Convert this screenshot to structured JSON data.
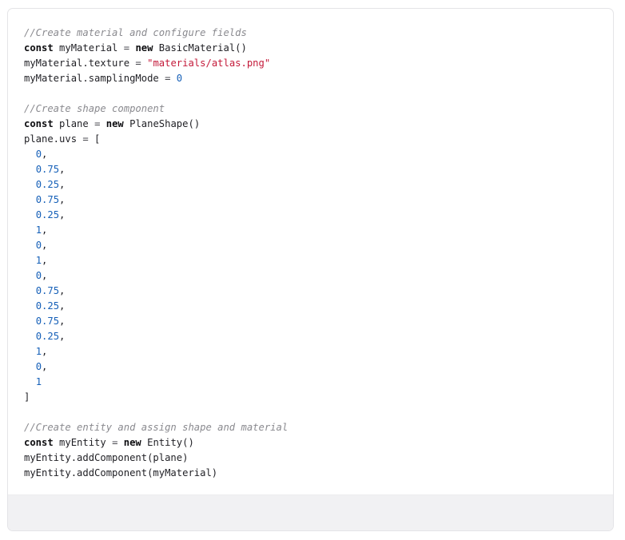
{
  "code_block": {
    "lines": [
      [
        {
          "t": "comment",
          "v": "//Create material and configure fields"
        }
      ],
      [
        {
          "t": "keyword",
          "v": "const"
        },
        {
          "t": "plain",
          "v": " myMaterial "
        },
        {
          "t": "op",
          "v": "="
        },
        {
          "t": "plain",
          "v": " "
        },
        {
          "t": "keyword",
          "v": "new"
        },
        {
          "t": "plain",
          "v": " BasicMaterial()"
        }
      ],
      [
        {
          "t": "plain",
          "v": "myMaterial.texture "
        },
        {
          "t": "op",
          "v": "="
        },
        {
          "t": "plain",
          "v": " "
        },
        {
          "t": "string",
          "v": "\"materials/atlas.png\""
        }
      ],
      [
        {
          "t": "plain",
          "v": "myMaterial.samplingMode "
        },
        {
          "t": "op",
          "v": "="
        },
        {
          "t": "plain",
          "v": " "
        },
        {
          "t": "number",
          "v": "0"
        }
      ],
      [],
      [
        {
          "t": "comment",
          "v": "//Create shape component"
        }
      ],
      [
        {
          "t": "keyword",
          "v": "const"
        },
        {
          "t": "plain",
          "v": " plane "
        },
        {
          "t": "op",
          "v": "="
        },
        {
          "t": "plain",
          "v": " "
        },
        {
          "t": "keyword",
          "v": "new"
        },
        {
          "t": "plain",
          "v": " PlaneShape()"
        }
      ],
      [
        {
          "t": "plain",
          "v": "plane.uvs "
        },
        {
          "t": "op",
          "v": "="
        },
        {
          "t": "plain",
          "v": " ["
        }
      ],
      [
        {
          "t": "plain",
          "v": "  "
        },
        {
          "t": "number",
          "v": "0"
        },
        {
          "t": "plain",
          "v": ","
        }
      ],
      [
        {
          "t": "plain",
          "v": "  "
        },
        {
          "t": "number",
          "v": "0.75"
        },
        {
          "t": "plain",
          "v": ","
        }
      ],
      [
        {
          "t": "plain",
          "v": "  "
        },
        {
          "t": "number",
          "v": "0.25"
        },
        {
          "t": "plain",
          "v": ","
        }
      ],
      [
        {
          "t": "plain",
          "v": "  "
        },
        {
          "t": "number",
          "v": "0.75"
        },
        {
          "t": "plain",
          "v": ","
        }
      ],
      [
        {
          "t": "plain",
          "v": "  "
        },
        {
          "t": "number",
          "v": "0.25"
        },
        {
          "t": "plain",
          "v": ","
        }
      ],
      [
        {
          "t": "plain",
          "v": "  "
        },
        {
          "t": "number",
          "v": "1"
        },
        {
          "t": "plain",
          "v": ","
        }
      ],
      [
        {
          "t": "plain",
          "v": "  "
        },
        {
          "t": "number",
          "v": "0"
        },
        {
          "t": "plain",
          "v": ","
        }
      ],
      [
        {
          "t": "plain",
          "v": "  "
        },
        {
          "t": "number",
          "v": "1"
        },
        {
          "t": "plain",
          "v": ","
        }
      ],
      [
        {
          "t": "plain",
          "v": "  "
        },
        {
          "t": "number",
          "v": "0"
        },
        {
          "t": "plain",
          "v": ","
        }
      ],
      [
        {
          "t": "plain",
          "v": "  "
        },
        {
          "t": "number",
          "v": "0.75"
        },
        {
          "t": "plain",
          "v": ","
        }
      ],
      [
        {
          "t": "plain",
          "v": "  "
        },
        {
          "t": "number",
          "v": "0.25"
        },
        {
          "t": "plain",
          "v": ","
        }
      ],
      [
        {
          "t": "plain",
          "v": "  "
        },
        {
          "t": "number",
          "v": "0.75"
        },
        {
          "t": "plain",
          "v": ","
        }
      ],
      [
        {
          "t": "plain",
          "v": "  "
        },
        {
          "t": "number",
          "v": "0.25"
        },
        {
          "t": "plain",
          "v": ","
        }
      ],
      [
        {
          "t": "plain",
          "v": "  "
        },
        {
          "t": "number",
          "v": "1"
        },
        {
          "t": "plain",
          "v": ","
        }
      ],
      [
        {
          "t": "plain",
          "v": "  "
        },
        {
          "t": "number",
          "v": "0"
        },
        {
          "t": "plain",
          "v": ","
        }
      ],
      [
        {
          "t": "plain",
          "v": "  "
        },
        {
          "t": "number",
          "v": "1"
        }
      ],
      [
        {
          "t": "plain",
          "v": "]"
        }
      ],
      [],
      [
        {
          "t": "comment",
          "v": "//Create entity and assign shape and material"
        }
      ],
      [
        {
          "t": "keyword",
          "v": "const"
        },
        {
          "t": "plain",
          "v": " myEntity "
        },
        {
          "t": "op",
          "v": "="
        },
        {
          "t": "plain",
          "v": " "
        },
        {
          "t": "keyword",
          "v": "new"
        },
        {
          "t": "plain",
          "v": " Entity()"
        }
      ],
      [
        {
          "t": "plain",
          "v": "myEntity.addComponent(plane)"
        }
      ],
      [
        {
          "t": "plain",
          "v": "myEntity.addComponent(myMaterial)"
        }
      ]
    ]
  },
  "colors": {
    "comment": "#8a8a8f",
    "keyword": "#0d0d10",
    "string": "#c41a3a",
    "number": "#1660b8",
    "footer_background": "#f1f1f3"
  }
}
